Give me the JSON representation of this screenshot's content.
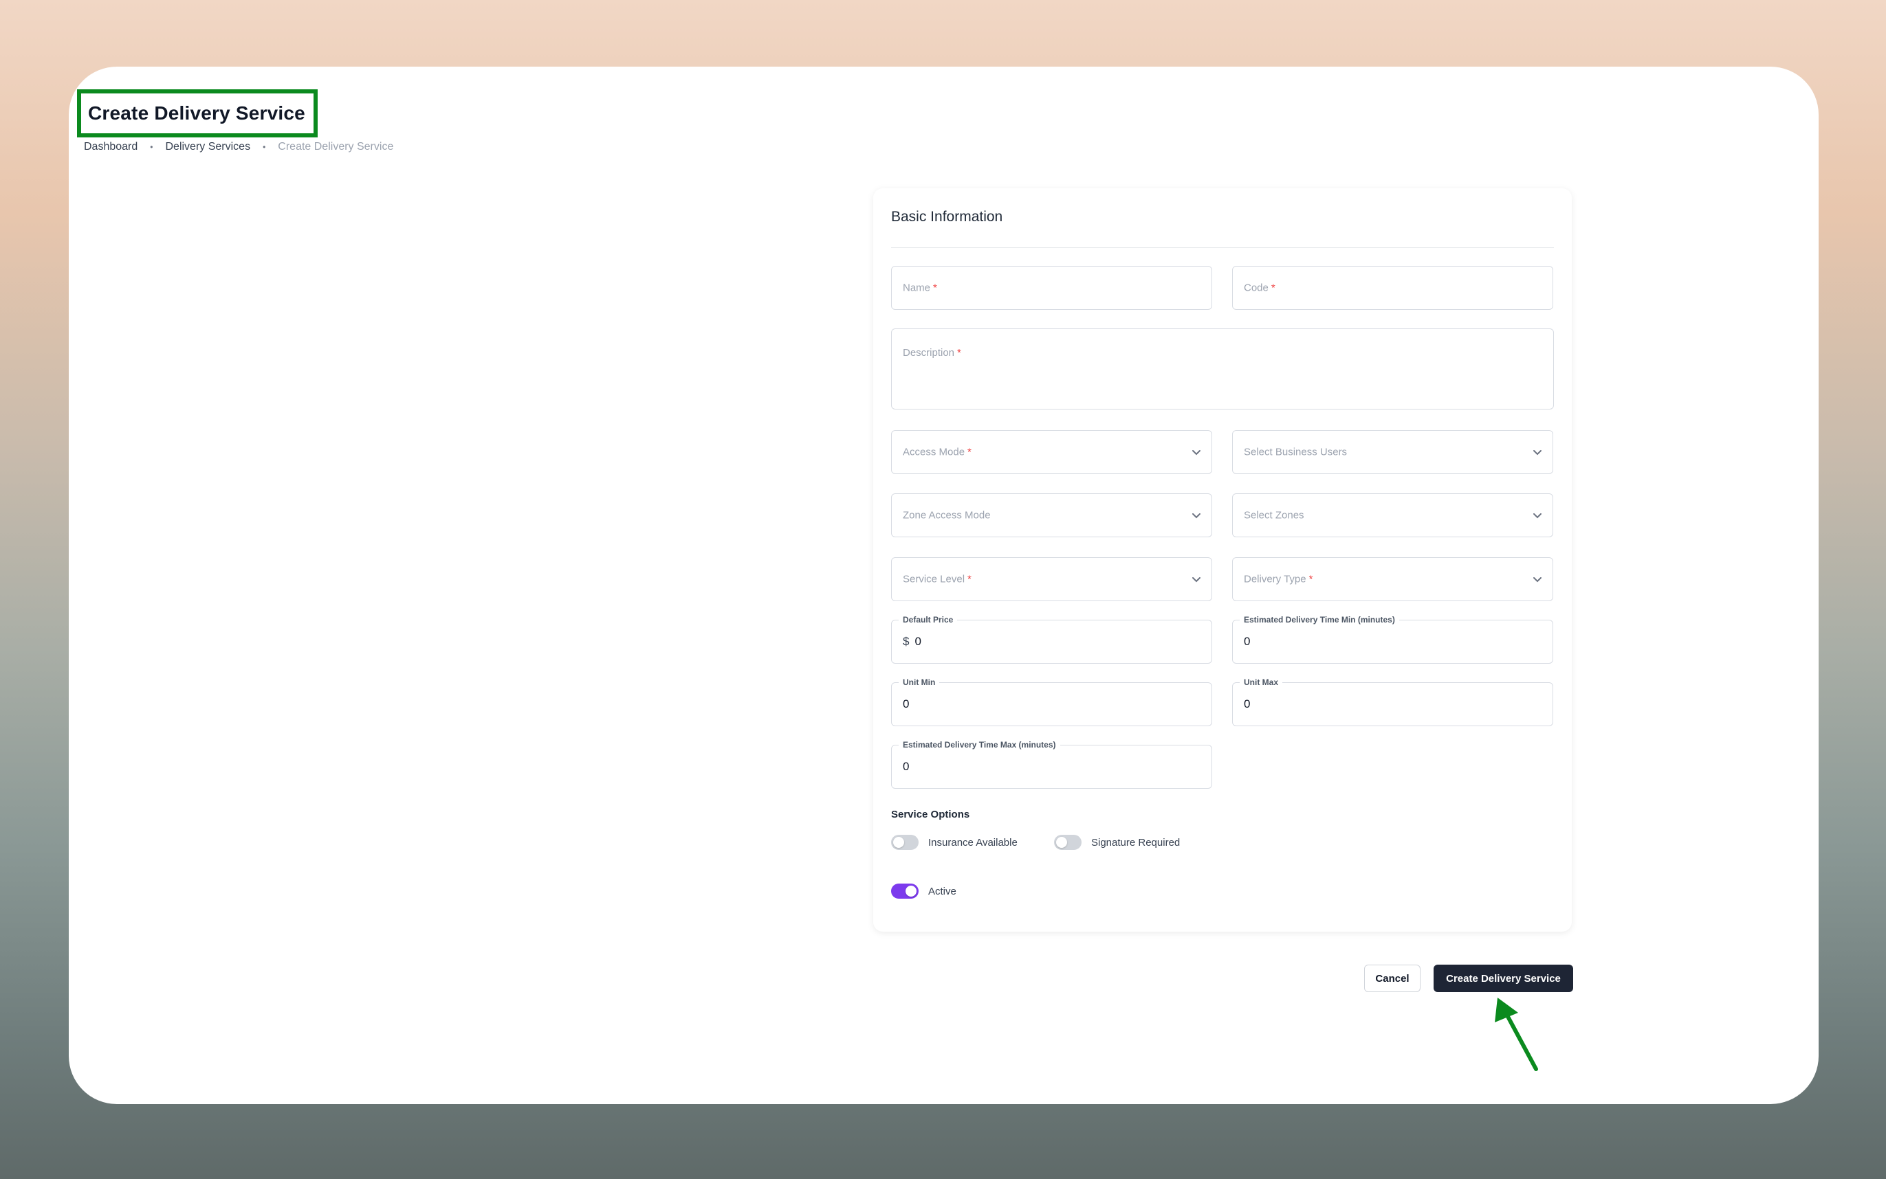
{
  "page": {
    "title": "Create Delivery Service",
    "breadcrumb": [
      "Dashboard",
      "Delivery Services",
      "Create Delivery Service"
    ]
  },
  "form": {
    "section_title": "Basic Information",
    "name": {
      "placeholder": "Name",
      "required_mark": "*"
    },
    "code": {
      "placeholder": "Code",
      "required_mark": "*"
    },
    "description": {
      "placeholder": "Description",
      "required_mark": "*"
    },
    "access_mode": {
      "placeholder": "Access Mode",
      "required_mark": "*"
    },
    "business_users": {
      "placeholder": "Select Business Users"
    },
    "zone_access_mode": {
      "placeholder": "Zone Access Mode"
    },
    "zones": {
      "placeholder": "Select Zones"
    },
    "service_level": {
      "placeholder": "Service Level",
      "required_mark": "*"
    },
    "delivery_type": {
      "placeholder": "Delivery Type",
      "required_mark": "*"
    },
    "default_price": {
      "label": "Default Price",
      "prefix": "$",
      "value": "0"
    },
    "est_time_min": {
      "label": "Estimated Delivery Time Min (minutes)",
      "value": "0"
    },
    "unit_min": {
      "label": "Unit Min",
      "value": "0"
    },
    "unit_max": {
      "label": "Unit Max",
      "value": "0"
    },
    "est_time_max": {
      "label": "Estimated Delivery Time Max (minutes)",
      "value": "0"
    },
    "service_options_label": "Service Options",
    "insurance": {
      "label": "Insurance Available",
      "on": false
    },
    "signature": {
      "label": "Signature Required",
      "on": false
    },
    "active": {
      "label": "Active",
      "on": true
    }
  },
  "actions": {
    "cancel_label": "Cancel",
    "submit_label": "Create Delivery Service"
  },
  "colors": {
    "accent": "#7c3aed",
    "primary_button": "#1e2535",
    "highlight": "#0b8a1e"
  }
}
